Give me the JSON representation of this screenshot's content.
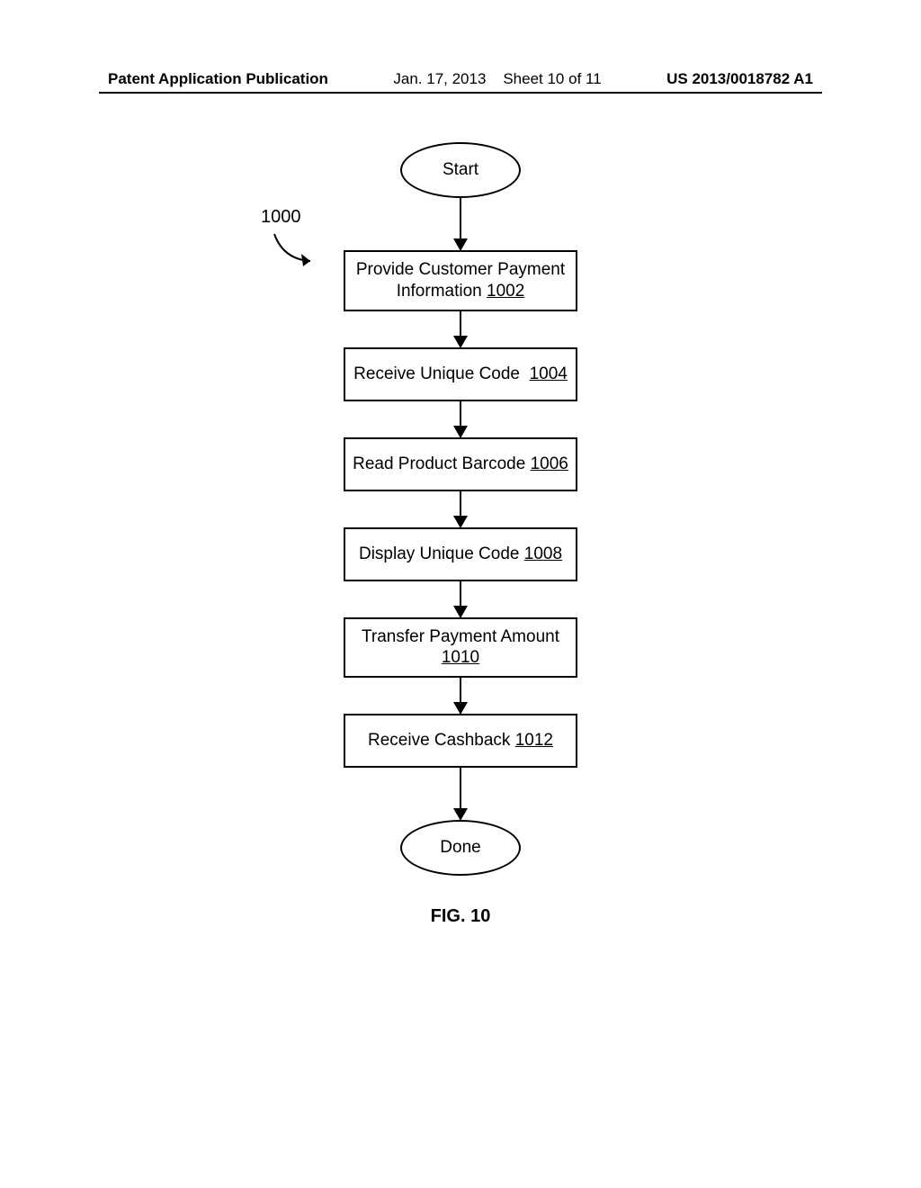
{
  "header": {
    "left": "Patent Application Publication",
    "date": "Jan. 17, 2013",
    "sheet": "Sheet 10 of 11",
    "pubno": "US 2013/0018782 A1"
  },
  "figure": {
    "ref": "1000",
    "label": "FIG. 10",
    "start": "Start",
    "done": "Done",
    "steps": [
      {
        "text": "Provide Customer Payment Information",
        "ref": "1002"
      },
      {
        "text": "Receive Unique Code",
        "ref": "1004"
      },
      {
        "text": "Read Product Barcode",
        "ref": "1006"
      },
      {
        "text": "Display Unique Code",
        "ref": "1008"
      },
      {
        "text": "Transfer Payment Amount",
        "ref": "1010"
      },
      {
        "text": "Receive Cashback",
        "ref": "1012"
      }
    ]
  }
}
